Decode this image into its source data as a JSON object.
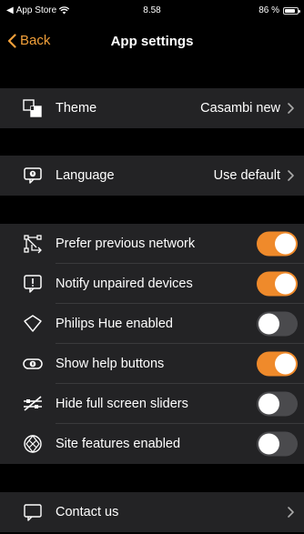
{
  "status_bar": {
    "carrier": "App Store",
    "time": "8.58",
    "battery_text": "86 %",
    "battery_level": 0.86
  },
  "nav": {
    "back_label": "Back",
    "title": "App settings"
  },
  "theme": {
    "label": "Theme",
    "value": "Casambi new",
    "icon": "theme-icon"
  },
  "language": {
    "label": "Language",
    "value": "Use default",
    "icon": "language-icon"
  },
  "settings": [
    {
      "label": "Prefer previous network",
      "on": true,
      "icon": "network-icon"
    },
    {
      "label": "Notify unpaired devices",
      "on": true,
      "icon": "alert-icon"
    },
    {
      "label": "Philips Hue enabled",
      "on": false,
      "icon": "hue-icon"
    },
    {
      "label": "Show help buttons",
      "on": true,
      "icon": "help-icon"
    },
    {
      "label": "Hide full screen sliders",
      "on": false,
      "icon": "sliders-icon"
    },
    {
      "label": "Site features enabled",
      "on": false,
      "icon": "site-icon"
    }
  ],
  "contact": {
    "label": "Contact us",
    "icon": "contact-icon"
  },
  "colors": {
    "accent": "#f2a03a",
    "toggle_on": "#ef8a2b",
    "toggle_off": "#4a4a4d",
    "row_bg": "#232325",
    "background": "#000000"
  }
}
